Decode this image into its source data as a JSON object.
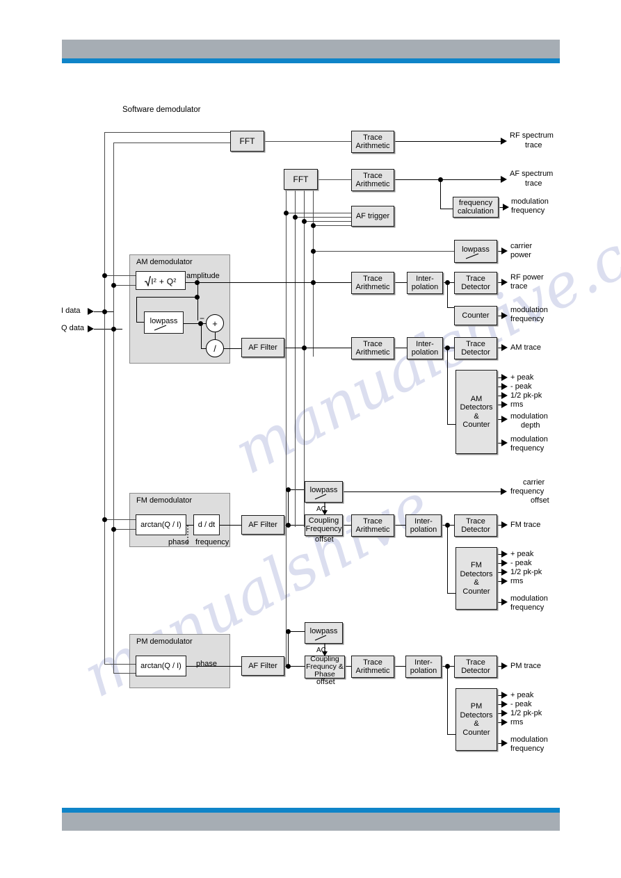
{
  "page": {
    "title": "Software demodulator",
    "header_color": "#a6adb4",
    "accent_color": "#0f84c8",
    "watermark_1": "manualshive.com",
    "watermark_2": "manualshive"
  },
  "inputs": [
    {
      "label": "I data"
    },
    {
      "label": "Q data"
    }
  ],
  "blocks": {
    "fft_rf": "FFT",
    "fft_af": "FFT",
    "trace_arith": "Trace\nArithmetic",
    "af_trigger": "AF trigger",
    "freq_calc": "frequency\ncalculation",
    "lowpass": "lowpass",
    "interpolation": "Inter-\npolation",
    "trace_detector": "Trace\nDetector",
    "counter": "Counter",
    "af_filter": "AF Filter",
    "coupling_fm": "Coupling\nFrequency",
    "coupling_pm": "Coupling\nFrequncy &\nPhase",
    "coupling_offset": "offset",
    "ac_label": "AC"
  },
  "trace_arithmetic": {
    "line1": "Trace",
    "line2": "Arithmetic"
  },
  "interpolation": {
    "line1": "Inter-",
    "line2": "polation"
  },
  "trace_detector": {
    "line1": "Trace",
    "line2": "Detector"
  },
  "frequency_calculation": {
    "line1": "frequency",
    "line2": "calculation"
  },
  "am_demod": {
    "title": "AM demodulator",
    "magnitude_formula": "I² + Q²",
    "amplitude_label": "amplitude",
    "lowpass_label": "lowpass",
    "sum_symbol": "+",
    "minus_symbol": "−",
    "divide_symbol": "/"
  },
  "fm_demod": {
    "title": "FM demodulator",
    "arctan_label": "arctan(Q / I)",
    "derivative_label": "d / dt",
    "phase_label": "phase",
    "frequency_label": "frequency"
  },
  "pm_demod": {
    "title": "PM demodulator",
    "arctan_label": "arctan(Q / I)",
    "phase_label": "phase"
  },
  "am_detectors": {
    "line1": "AM",
    "line2": "Detectors",
    "line3": "&",
    "line4": "Counter",
    "outputs": [
      "+ peak",
      "- peak",
      "1/2 pk-pk",
      "rms",
      "modulation\ndepth",
      "modulation\nfrequency"
    ]
  },
  "fm_detectors": {
    "line1": "FM",
    "line2": "Detectors",
    "line3": "&",
    "line4": "Counter",
    "outputs": [
      "+ peak",
      "- peak",
      "1/2 pk-pk",
      "rms",
      "modulation\nfrequency"
    ]
  },
  "pm_detectors": {
    "line1": "PM",
    "line2": "Detectors",
    "line3": "&",
    "line4": "Counter",
    "outputs": [
      "+ peak",
      "- peak",
      "1/2 pk-pk",
      "rms",
      "modulation\nfrequency"
    ]
  },
  "outputs": {
    "rf_spectrum_1": "RF spectrum",
    "rf_spectrum_2": "trace",
    "af_spectrum_1": "AF spectrum",
    "af_spectrum_2": "trace",
    "modulation_freq_1": "modulation",
    "modulation_freq_2": "frequency",
    "carrier_power_1": "carrier",
    "carrier_power_2": "power",
    "rf_power_1": "RF power",
    "rf_power_2": "trace",
    "mod_freq_counter_1": "modulation",
    "mod_freq_counter_2": "frequency",
    "am_trace": "AM trace",
    "carrier_freq_offset_1": "carrier",
    "carrier_freq_offset_2": "frequency",
    "carrier_freq_offset_3": "offset",
    "fm_trace": "FM trace",
    "pm_trace": "PM trace"
  },
  "am_out_labels": {
    "p1": "+ peak",
    "p2": "- peak",
    "p3": "1/2 pk-pk",
    "p4": "rms",
    "p5a": "modulation",
    "p5b": "depth",
    "p6a": "modulation",
    "p6b": "frequency"
  },
  "fm_out_labels": {
    "p1": "+ peak",
    "p2": "- peak",
    "p3": "1/2 pk-pk",
    "p4": "rms",
    "p5a": "modulation",
    "p5b": "frequency"
  },
  "pm_out_labels": {
    "p1": "+ peak",
    "p2": "- peak",
    "p3": "1/2 pk-pk",
    "p4": "rms",
    "p5a": "modulation",
    "p5b": "frequency"
  }
}
